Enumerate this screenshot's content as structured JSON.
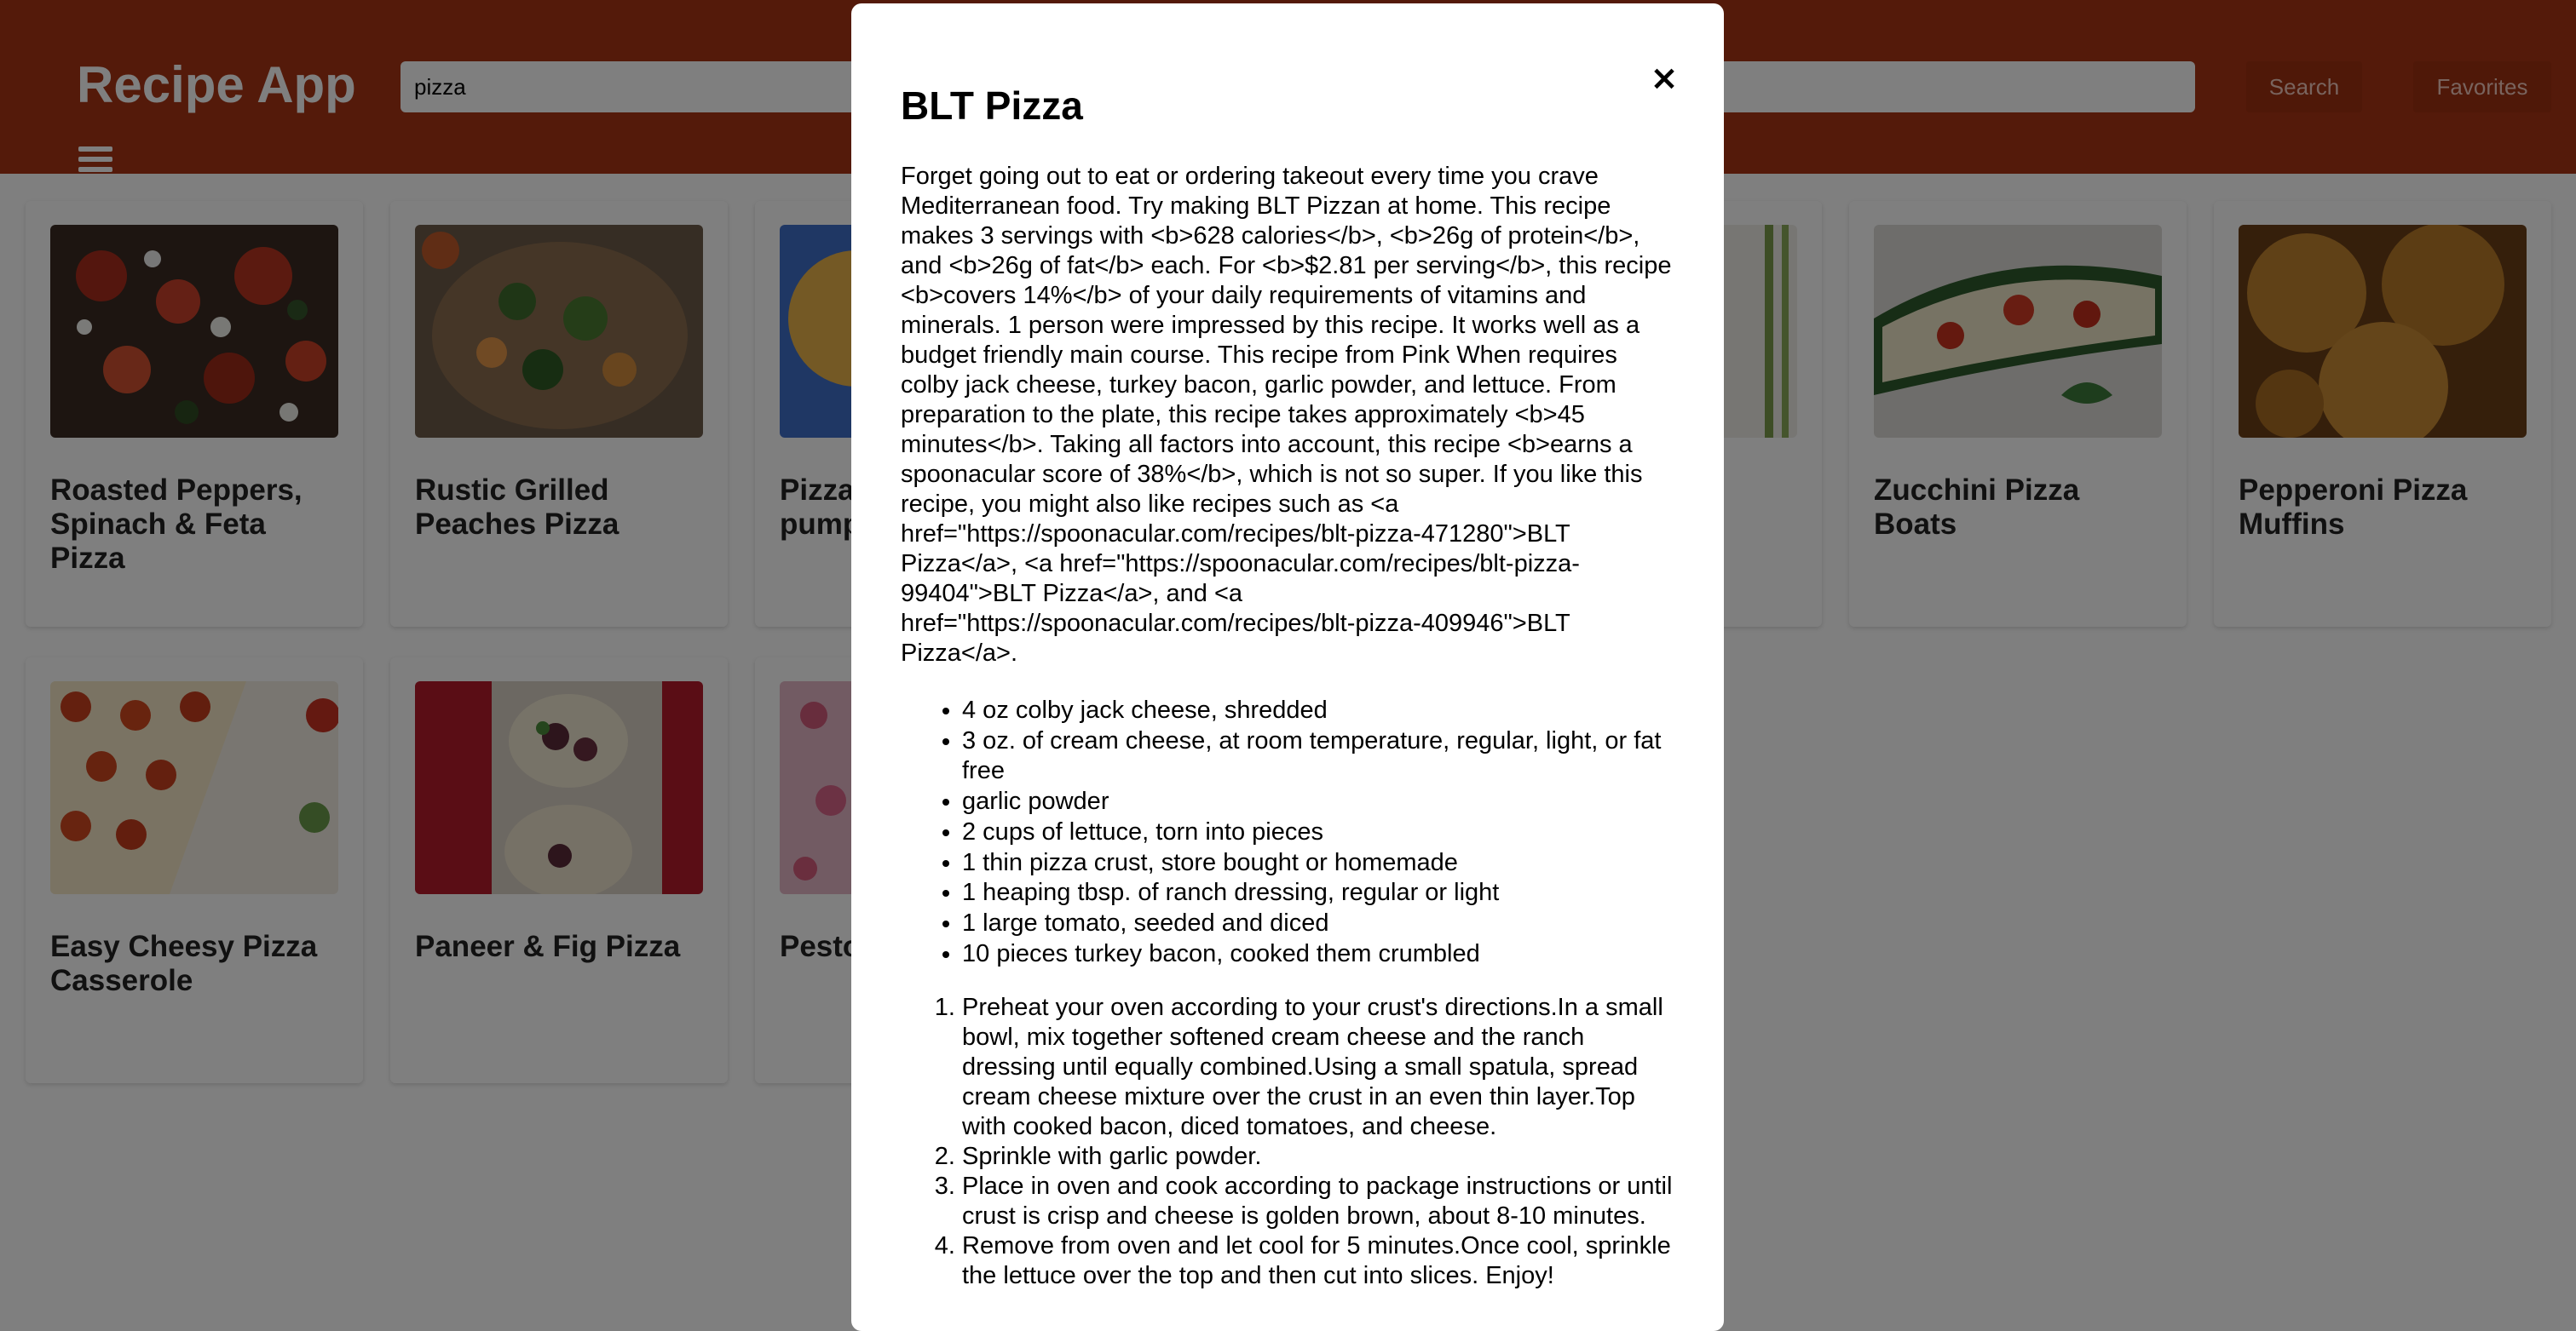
{
  "header": {
    "app_title": "Recipe App",
    "search_value": "pizza",
    "search_button": "Search",
    "favorites_button": "Favorites"
  },
  "recipes": [
    {
      "title": "Roasted Peppers, Spinach & Feta Pizza"
    },
    {
      "title": "Rustic Grilled Peaches Pizza"
    },
    {
      "title": "Pizza bites with pumpkin"
    },
    {
      "title": ""
    },
    {
      "title": ""
    },
    {
      "title": "Zucchini Pizza Boats"
    },
    {
      "title": "Pepperoni Pizza Muffins"
    },
    {
      "title": "Easy Cheesy Pizza Casserole"
    },
    {
      "title": "Paneer & Fig Pizza"
    },
    {
      "title": "Pesto"
    }
  ],
  "modal": {
    "title": "BLT Pizza",
    "close_label": "×",
    "summary": "Forget going out to eat or ordering takeout every time you crave Mediterranean food. Try making BLT Pizzan at home. This recipe makes 3 servings with <b>628 calories</b>, <b>26g of protein</b>, and <b>26g of fat</b> each. For <b>$2.81 per serving</b>, this recipe <b>covers 14%</b> of your daily requirements of vitamins and minerals. 1 person were impressed by this recipe. It works well as a budget friendly main course. This recipe from Pink When requires colby jack cheese, turkey bacon, garlic powder, and lettuce. From preparation to the plate, this recipe takes approximately <b>45 minutes</b>. Taking all factors into account, this recipe <b>earns a spoonacular score of 38%</b>, which is not so super. If you like this recipe, you might also like recipes such as <a href=\"https://spoonacular.com/recipes/blt-pizza-471280\">BLT Pizza</a>, <a href=\"https://spoonacular.com/recipes/blt-pizza-99404\">BLT Pizza</a>, and <a href=\"https://spoonacular.com/recipes/blt-pizza-409946\">BLT Pizza</a>.",
    "ingredients": [
      "4 oz colby jack cheese, shredded",
      "3 oz. of cream cheese, at room temperature, regular, light, or fat free",
      "garlic powder",
      "2 cups of lettuce, torn into pieces",
      "1 thin pizza crust, store bought or homemade",
      "1 heaping tbsp. of ranch dressing, regular or light",
      "1 large tomato, seeded and diced",
      "10 pieces turkey bacon, cooked them crumbled"
    ],
    "instructions": [
      "Preheat your oven according to your crust's directions.In a small bowl, mix together softened cream cheese and the ranch dressing until equally combined.Using a small spatula, spread cream cheese mixture over the crust in an even thin layer.Top with cooked bacon, diced tomatoes, and cheese.",
      "Sprinkle with garlic powder.",
      "Place in oven and cook according to package instructions or until crust is crisp and cheese is golden brown, about 8-10 minutes.",
      "Remove from oven and let cool for 5 minutes.Once cool, sprinkle the lettuce over the top and then cut into slices. Enjoy!"
    ]
  }
}
